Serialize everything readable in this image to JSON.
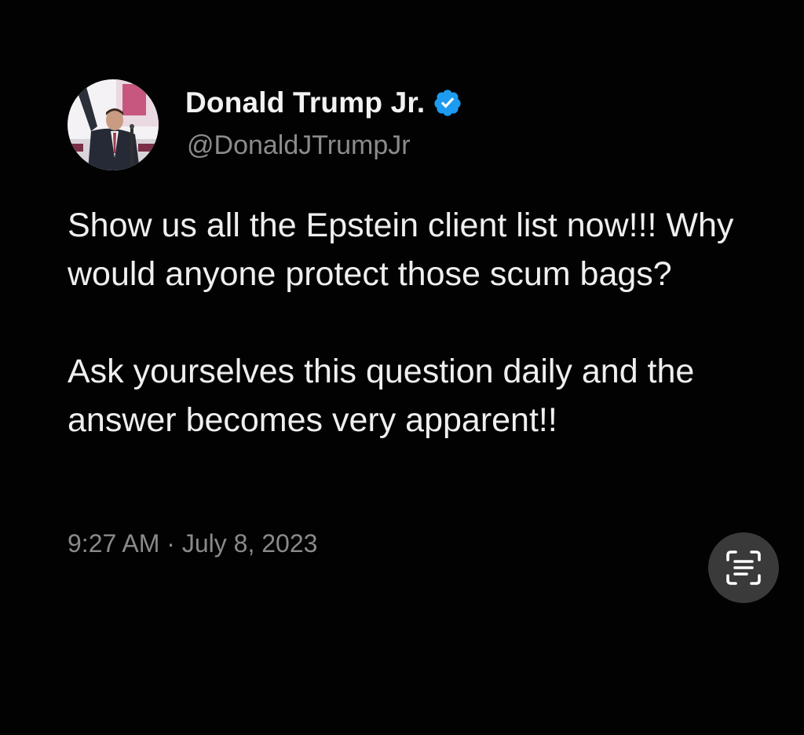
{
  "tweet": {
    "author": {
      "display_name": "Donald Trump Jr.",
      "handle": "@DonaldJTrumpJr",
      "verified": true,
      "verified_icon": "verified-badge-icon",
      "verified_color": "#1d9bf0"
    },
    "paragraphs": [
      "Show us all the Epstein client list now!!! Why would anyone protect those scum bags?",
      "Ask yourselves this question daily and the answer becomes very apparent!!"
    ],
    "timestamp": "9:27 AM · July 8, 2023"
  },
  "overlay": {
    "scan_button_icon": "text-scan-icon"
  },
  "colors": {
    "background": "#020202",
    "text": "#efefef",
    "muted": "#8a8a8a"
  }
}
